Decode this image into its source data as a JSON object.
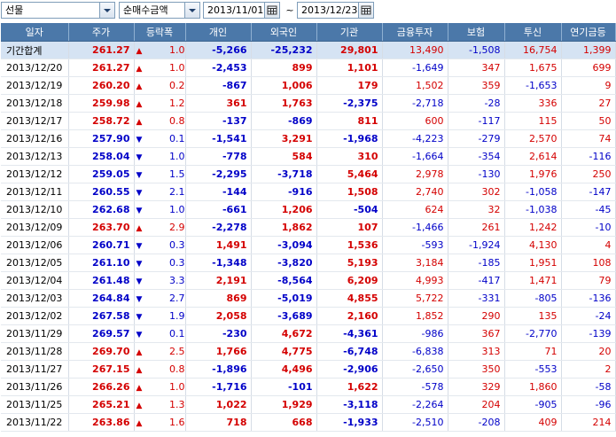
{
  "toolbar": {
    "market_select": "선물",
    "amount_select": "순매수금액",
    "date_from": "2013/11/01",
    "date_to": "2013/12/23",
    "range_separator": "~"
  },
  "headers": [
    "일자",
    "주가",
    "등락폭",
    "개인",
    "외국인",
    "기관",
    "금융투자",
    "보험",
    "투신",
    "연기금등"
  ],
  "colors": {
    "up": "#d40000",
    "down": "#0000c8",
    "header_bg": "#4b78a9",
    "total_bg": "#d5e3f3"
  },
  "rows": [
    {
      "date": "기간합계",
      "price": "261.27",
      "dir": "up",
      "chg": "1.07",
      "indiv": "-5,266",
      "foreign": "-25,232",
      "inst": "29,801",
      "fin": "13,490",
      "ins": "-1,508",
      "trust": "16,754",
      "pension": "1,399"
    },
    {
      "date": "2013/12/20",
      "price": "261.27",
      "dir": "up",
      "chg": "1.07",
      "indiv": "-2,453",
      "foreign": "899",
      "inst": "1,101",
      "fin": "-1,649",
      "ins": "347",
      "trust": "1,675",
      "pension": "699"
    },
    {
      "date": "2013/12/19",
      "price": "260.20",
      "dir": "up",
      "chg": "0.22",
      "indiv": "-867",
      "foreign": "1,006",
      "inst": "179",
      "fin": "1,502",
      "ins": "359",
      "trust": "-1,653",
      "pension": "9"
    },
    {
      "date": "2013/12/18",
      "price": "259.98",
      "dir": "up",
      "chg": "1.26",
      "indiv": "361",
      "foreign": "1,763",
      "inst": "-2,375",
      "fin": "-2,718",
      "ins": "-28",
      "trust": "336",
      "pension": "27"
    },
    {
      "date": "2013/12/17",
      "price": "258.72",
      "dir": "up",
      "chg": "0.82",
      "indiv": "-137",
      "foreign": "-869",
      "inst": "811",
      "fin": "600",
      "ins": "-117",
      "trust": "115",
      "pension": "50"
    },
    {
      "date": "2013/12/16",
      "price": "257.90",
      "dir": "down",
      "chg": "0.14",
      "indiv": "-1,541",
      "foreign": "3,291",
      "inst": "-1,968",
      "fin": "-4,223",
      "ins": "-279",
      "trust": "2,570",
      "pension": "74"
    },
    {
      "date": "2013/12/13",
      "price": "258.04",
      "dir": "down",
      "chg": "1.01",
      "indiv": "-778",
      "foreign": "584",
      "inst": "310",
      "fin": "-1,664",
      "ins": "-354",
      "trust": "2,614",
      "pension": "-116"
    },
    {
      "date": "2013/12/12",
      "price": "259.05",
      "dir": "down",
      "chg": "1.50",
      "indiv": "-2,295",
      "foreign": "-3,718",
      "inst": "5,464",
      "fin": "2,978",
      "ins": "-130",
      "trust": "1,976",
      "pension": "250"
    },
    {
      "date": "2013/12/11",
      "price": "260.55",
      "dir": "down",
      "chg": "2.13",
      "indiv": "-144",
      "foreign": "-916",
      "inst": "1,508",
      "fin": "2,740",
      "ins": "302",
      "trust": "-1,058",
      "pension": "-147"
    },
    {
      "date": "2013/12/10",
      "price": "262.68",
      "dir": "down",
      "chg": "1.02",
      "indiv": "-661",
      "foreign": "1,206",
      "inst": "-504",
      "fin": "624",
      "ins": "32",
      "trust": "-1,038",
      "pension": "-45"
    },
    {
      "date": "2013/12/09",
      "price": "263.70",
      "dir": "up",
      "chg": "2.99",
      "indiv": "-2,278",
      "foreign": "1,862",
      "inst": "107",
      "fin": "-1,466",
      "ins": "261",
      "trust": "1,242",
      "pension": "-10"
    },
    {
      "date": "2013/12/06",
      "price": "260.71",
      "dir": "down",
      "chg": "0.39",
      "indiv": "1,491",
      "foreign": "-3,094",
      "inst": "1,536",
      "fin": "-593",
      "ins": "-1,924",
      "trust": "4,130",
      "pension": "4"
    },
    {
      "date": "2013/12/05",
      "price": "261.10",
      "dir": "down",
      "chg": "0.38",
      "indiv": "-1,348",
      "foreign": "-3,820",
      "inst": "5,193",
      "fin": "3,184",
      "ins": "-185",
      "trust": "1,951",
      "pension": "108"
    },
    {
      "date": "2013/12/04",
      "price": "261.48",
      "dir": "down",
      "chg": "3.36",
      "indiv": "2,191",
      "foreign": "-8,564",
      "inst": "6,209",
      "fin": "4,993",
      "ins": "-417",
      "trust": "1,471",
      "pension": "79"
    },
    {
      "date": "2013/12/03",
      "price": "264.84",
      "dir": "down",
      "chg": "2.74",
      "indiv": "869",
      "foreign": "-5,019",
      "inst": "4,855",
      "fin": "5,722",
      "ins": "-331",
      "trust": "-805",
      "pension": "-136"
    },
    {
      "date": "2013/12/02",
      "price": "267.58",
      "dir": "down",
      "chg": "1.99",
      "indiv": "2,058",
      "foreign": "-3,689",
      "inst": "2,160",
      "fin": "1,852",
      "ins": "290",
      "trust": "135",
      "pension": "-24"
    },
    {
      "date": "2013/11/29",
      "price": "269.57",
      "dir": "down",
      "chg": "0.13",
      "indiv": "-230",
      "foreign": "4,672",
      "inst": "-4,361",
      "fin": "-986",
      "ins": "367",
      "trust": "-2,770",
      "pension": "-139"
    },
    {
      "date": "2013/11/28",
      "price": "269.70",
      "dir": "up",
      "chg": "2.55",
      "indiv": "1,766",
      "foreign": "4,775",
      "inst": "-6,748",
      "fin": "-6,838",
      "ins": "313",
      "trust": "71",
      "pension": "20"
    },
    {
      "date": "2013/11/27",
      "price": "267.15",
      "dir": "up",
      "chg": "0.89",
      "indiv": "-1,896",
      "foreign": "4,496",
      "inst": "-2,906",
      "fin": "-2,650",
      "ins": "350",
      "trust": "-553",
      "pension": "2"
    },
    {
      "date": "2013/11/26",
      "price": "266.26",
      "dir": "up",
      "chg": "1.05",
      "indiv": "-1,716",
      "foreign": "-101",
      "inst": "1,622",
      "fin": "-578",
      "ins": "329",
      "trust": "1,860",
      "pension": "-58"
    },
    {
      "date": "2013/11/25",
      "price": "265.21",
      "dir": "up",
      "chg": "1.35",
      "indiv": "1,022",
      "foreign": "1,929",
      "inst": "-3,118",
      "fin": "-2,264",
      "ins": "204",
      "trust": "-905",
      "pension": "-96"
    },
    {
      "date": "2013/11/22",
      "price": "263.86",
      "dir": "up",
      "chg": "1.66",
      "indiv": "718",
      "foreign": "668",
      "inst": "-1,933",
      "fin": "-2,510",
      "ins": "-208",
      "trust": "409",
      "pension": "214"
    }
  ]
}
